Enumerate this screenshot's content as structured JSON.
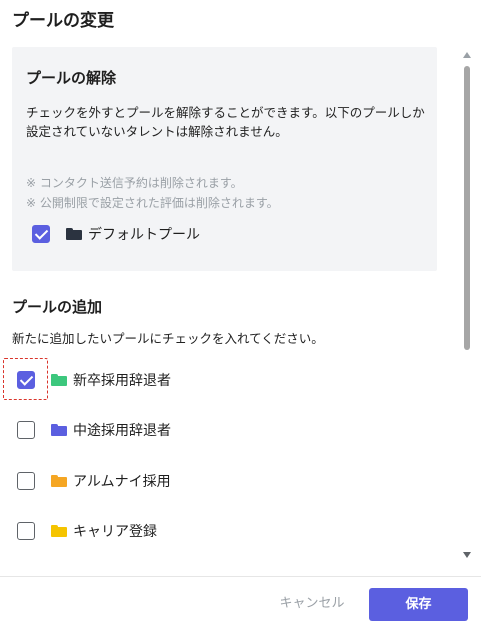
{
  "dialog": {
    "title": "プールの変更"
  },
  "release": {
    "heading": "プールの解除",
    "description": "チェックを外すとプールを解除することができます。以下のプールしか設定されていないタレントは解除されません。",
    "notes": [
      "※ コンタクト送信予約は削除されます。",
      "※ 公開制限で設定された評価は削除されます。"
    ],
    "pools": [
      {
        "label": "デフォルトプール",
        "checked": true,
        "folder_color": "#2b3340",
        "icon": "folder-icon"
      }
    ]
  },
  "add": {
    "heading": "プールの追加",
    "description": "新たに追加したいプールにチェックを入れてください。",
    "pools": [
      {
        "label": "新卒採用辞退者",
        "checked": true,
        "folder_color": "#3cc77d",
        "icon": "folder-icon"
      },
      {
        "label": "中途採用辞退者",
        "checked": false,
        "folder_color": "#5b5fe0",
        "icon": "folder-icon"
      },
      {
        "label": "アルムナイ採用",
        "checked": false,
        "folder_color": "#f5a623",
        "icon": "folder-icon"
      },
      {
        "label": "キャリア登録",
        "checked": false,
        "folder_color": "#f5c400",
        "icon": "folder-icon"
      }
    ]
  },
  "footer": {
    "cancel_label": "キャンセル",
    "save_label": "保存"
  },
  "colors": {
    "accent": "#5b5fe0",
    "highlight": "#d9342b"
  }
}
